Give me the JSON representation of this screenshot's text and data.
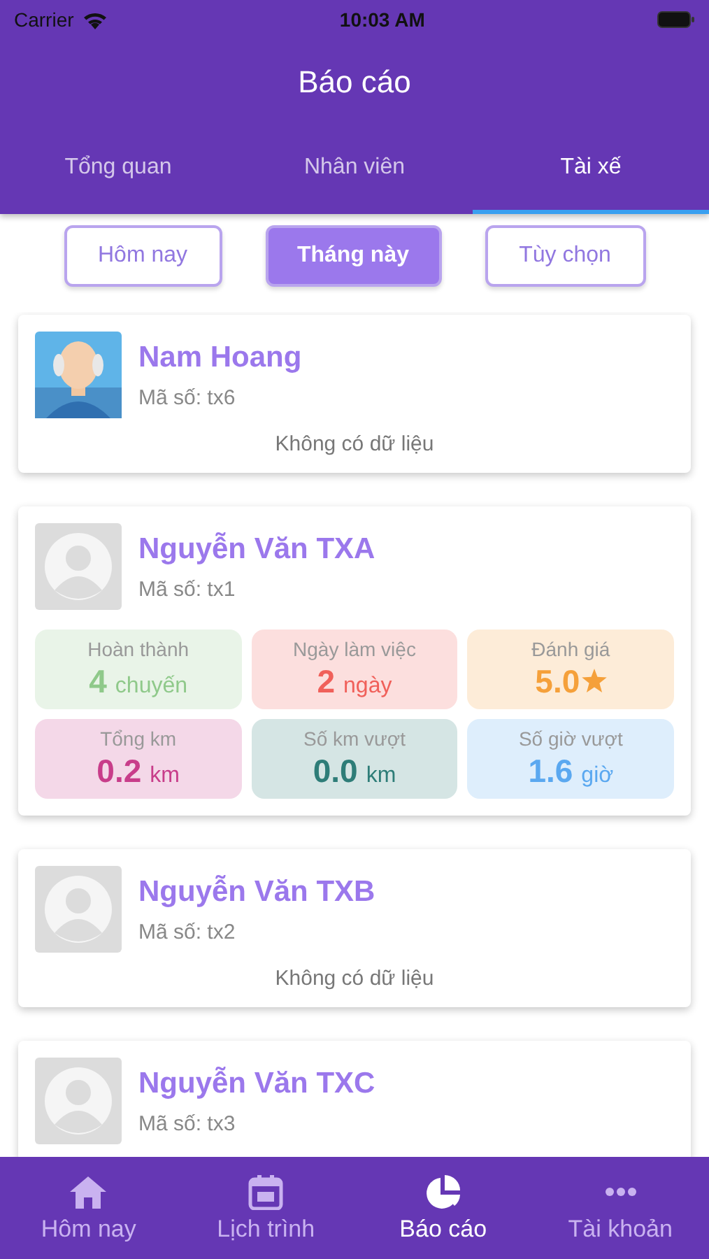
{
  "status_bar": {
    "carrier": "Carrier",
    "time": "10:03 AM"
  },
  "header": {
    "title": "Báo cáo"
  },
  "tabs": [
    {
      "label": "Tổng quan",
      "selected": false
    },
    {
      "label": "Nhân viên",
      "selected": false
    },
    {
      "label": "Tài xế",
      "selected": true
    }
  ],
  "filters": [
    {
      "label": "Hôm nay",
      "selected": false
    },
    {
      "label": "Tháng này",
      "selected": true
    },
    {
      "label": "Tùy chọn",
      "selected": false
    }
  ],
  "drivers": [
    {
      "name": "Nam Hoang",
      "code": "Mã số: tx6",
      "avatar": {
        "kind": "figure"
      },
      "empty_text": "Không có dữ liệu"
    },
    {
      "name": "Nguyễn Văn TXA",
      "code": "Mã số: tx1",
      "avatar": {
        "kind": "placeholder"
      },
      "stats": [
        {
          "kind": "unit",
          "label": "Hoàn thành",
          "value": "4",
          "unit": "chuyến",
          "color": "#8fc98a"
        },
        {
          "kind": "unit",
          "label": "Ngày làm việc",
          "value": "2",
          "unit": "ngày",
          "color": "#f0605a"
        },
        {
          "kind": "rating",
          "label": "Đánh giá",
          "value": "5.0",
          "color": "#f5a03a"
        },
        {
          "kind": "unit",
          "label": "Tổng km",
          "value": "0.2",
          "unit": "km",
          "color": "#c83d8a"
        },
        {
          "kind": "unit",
          "label": "Số km vượt",
          "value": "0.0",
          "unit": "km",
          "color": "#2e7d78"
        },
        {
          "kind": "unit",
          "label": "Số giờ vượt",
          "value": "1.6",
          "unit": "giờ",
          "color": "#5aa8f0"
        }
      ]
    },
    {
      "name": "Nguyễn Văn TXB",
      "code": "Mã số: tx2",
      "avatar": {
        "kind": "placeholder"
      },
      "empty_text": "Không có dữ liệu"
    },
    {
      "name": "Nguyễn Văn TXC",
      "code": "Mã số: tx3",
      "avatar": {
        "kind": "placeholder"
      }
    }
  ],
  "bottom_nav": [
    {
      "label": "Hôm nay",
      "kind": "home",
      "selected": false
    },
    {
      "label": "Lịch trình",
      "kind": "calendar",
      "selected": false
    },
    {
      "label": "Báo cáo",
      "kind": "pie",
      "selected": true
    },
    {
      "label": "Tài khoản",
      "kind": "more",
      "selected": false
    }
  ]
}
